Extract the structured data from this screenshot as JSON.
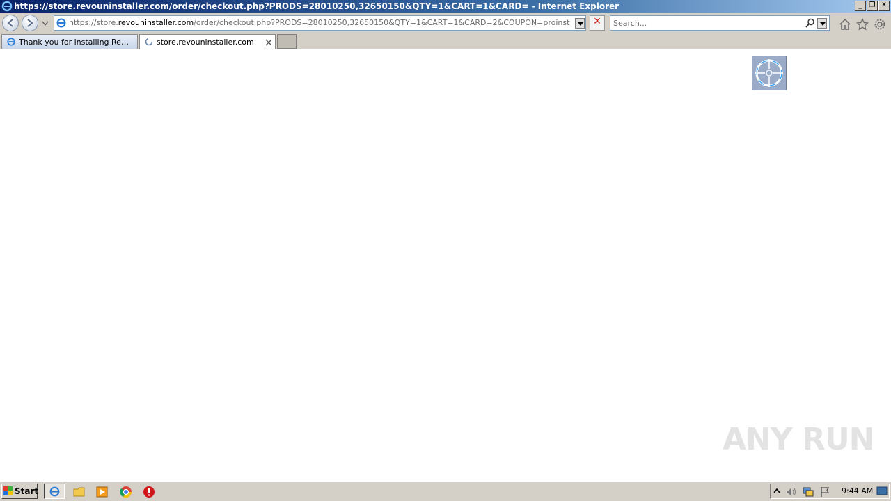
{
  "window": {
    "title": "https://store.revouninstaller.com/order/checkout.php?PRODS=28010250,32650150&QTY=1&CART=1&CARD= - Internet Explorer"
  },
  "address": {
    "prefix": "https://store.",
    "domain": "revouninstaller.com",
    "suffix": "/order/checkout.php?PRODS=28010250,32650150&QTY=1&CART=1&CARD=2&COUPON=proinstalltypop&SHORT_I"
  },
  "search": {
    "placeholder": "Search..."
  },
  "tabs": [
    {
      "label": "Thank you for installing Revo U..."
    },
    {
      "label": "store.revouninstaller.com"
    }
  ],
  "watermark": "ANY RUN",
  "taskbar": {
    "start_label": "Start",
    "clock": "9:44 AM"
  }
}
